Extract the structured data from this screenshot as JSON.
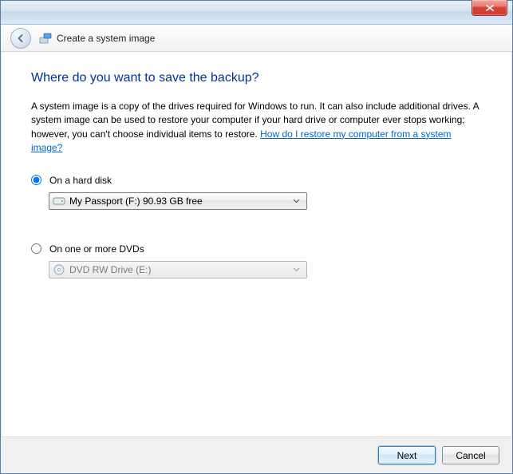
{
  "header": {
    "title": "Create a system image"
  },
  "heading": "Where do you want to save the backup?",
  "description_part1": "A system image is a copy of the drives required for Windows to run. It can also include additional drives. A system image can be used to restore your computer if your hard drive or computer ever stops working; however, you can't choose individual items to restore. ",
  "description_link": "How do I restore my computer from a system image?",
  "options": {
    "hard_disk": {
      "label": "On a hard disk",
      "selected": true,
      "dropdown_value": "My Passport (F:)  90.93 GB free",
      "enabled": true
    },
    "dvd": {
      "label": "On one or more DVDs",
      "selected": false,
      "dropdown_value": "DVD RW Drive (E:)",
      "enabled": false
    }
  },
  "footer": {
    "next": "Next",
    "cancel": "Cancel"
  }
}
